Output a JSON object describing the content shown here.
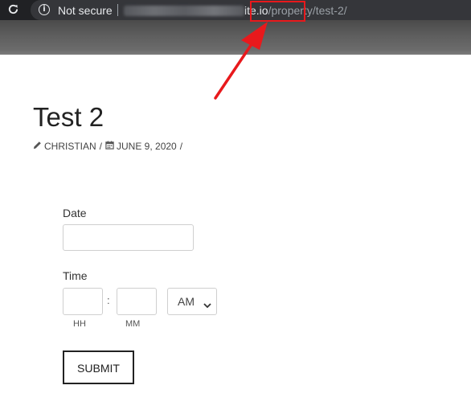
{
  "browser": {
    "security_label": "Not secure",
    "url_host_suffix": "ite.io",
    "url_path": "/property/test-2/"
  },
  "post": {
    "title": "Test 2",
    "author": "CHRISTIAN",
    "date": "JUNE 9, 2020",
    "meta_separator": "/"
  },
  "form": {
    "date_label": "Date",
    "date_value": "",
    "time_label": "Time",
    "hour_value": "",
    "minute_value": "",
    "time_separator": ":",
    "ampm_selected": "AM",
    "hour_sublabel": "HH",
    "minute_sublabel": "MM",
    "submit_label": "SUBMIT"
  },
  "annotation": {
    "color": "#e8191c"
  }
}
